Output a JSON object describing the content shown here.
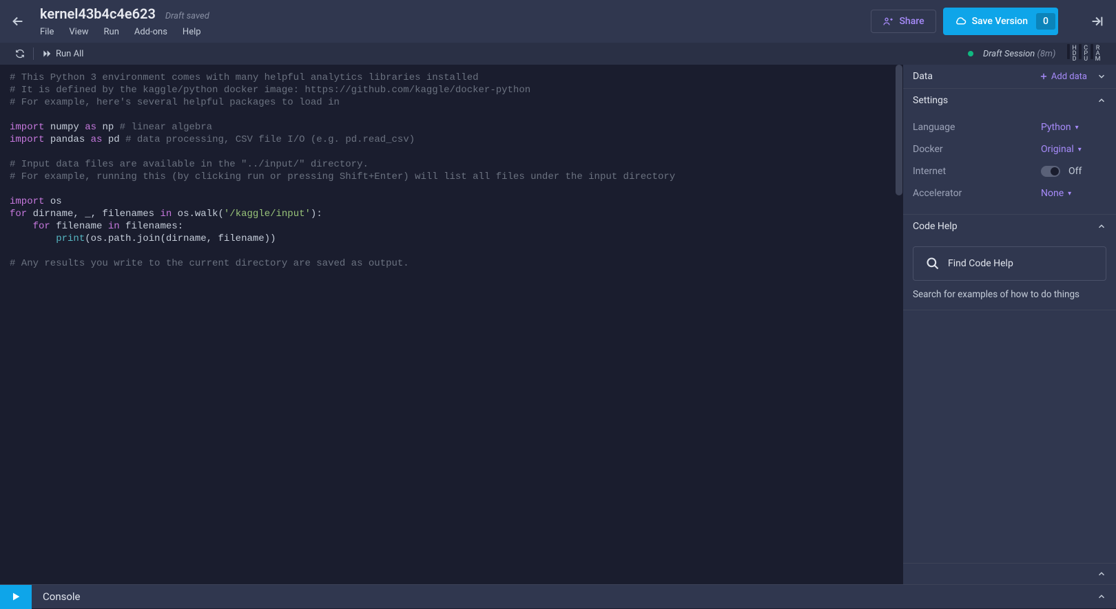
{
  "header": {
    "title": "kernel43b4c4e623",
    "status": "Draft saved",
    "menu": [
      "File",
      "View",
      "Run",
      "Add-ons",
      "Help"
    ],
    "share": "Share",
    "save": "Save Version",
    "save_count": "0"
  },
  "toolbar": {
    "run_all": "Run All",
    "session_label": "Draft Session",
    "session_time": "(8m)",
    "meters": [
      "HDD",
      "CPU",
      "RAM"
    ]
  },
  "sidebar": {
    "data_title": "Data",
    "add_data": "Add data",
    "settings_title": "Settings",
    "settings": {
      "language_label": "Language",
      "language_value": "Python",
      "docker_label": "Docker",
      "docker_value": "Original",
      "internet_label": "Internet",
      "internet_value": "Off",
      "accelerator_label": "Accelerator",
      "accelerator_value": "None"
    },
    "code_help_title": "Code Help",
    "find_code_help": "Find Code Help",
    "code_help_hint": "Search for examples of how to do things"
  },
  "console": {
    "label": "Console"
  },
  "code": {
    "l1": "# This Python 3 environment comes with many helpful analytics libraries installed",
    "l2": "# It is defined by the kaggle/python docker image: https://github.com/kaggle/docker-python",
    "l3": "# For example, here's several helpful packages to load in ",
    "import_kw": "import",
    "as_kw": "as",
    "for_kw": "for",
    "in_kw": "in",
    "numpy": " numpy ",
    "np": " np ",
    "l5c": "# linear algebra",
    "pandas": " pandas ",
    "pd": " pd ",
    "l6c": "# data processing, CSV file I/O (e.g. pd.read_csv)",
    "l8": "# Input data files are available in the \"../input/\" directory.",
    "l9": "# For example, running this (by clicking run or pressing Shift+Enter) will list all files under the input directory",
    "os": " os",
    "l12a": " dirname, _, filenames ",
    "l12b": " os.walk(",
    "str1": "'/kaggle/input'",
    "l12c": "):",
    "l13a": "    ",
    "l13b": " filename ",
    "l13c": " filenames:",
    "l14a": "        ",
    "print": "print",
    "l14b": "(os.path.join(dirname, filename))",
    "l16": "# Any results you write to the current directory are saved as output."
  }
}
